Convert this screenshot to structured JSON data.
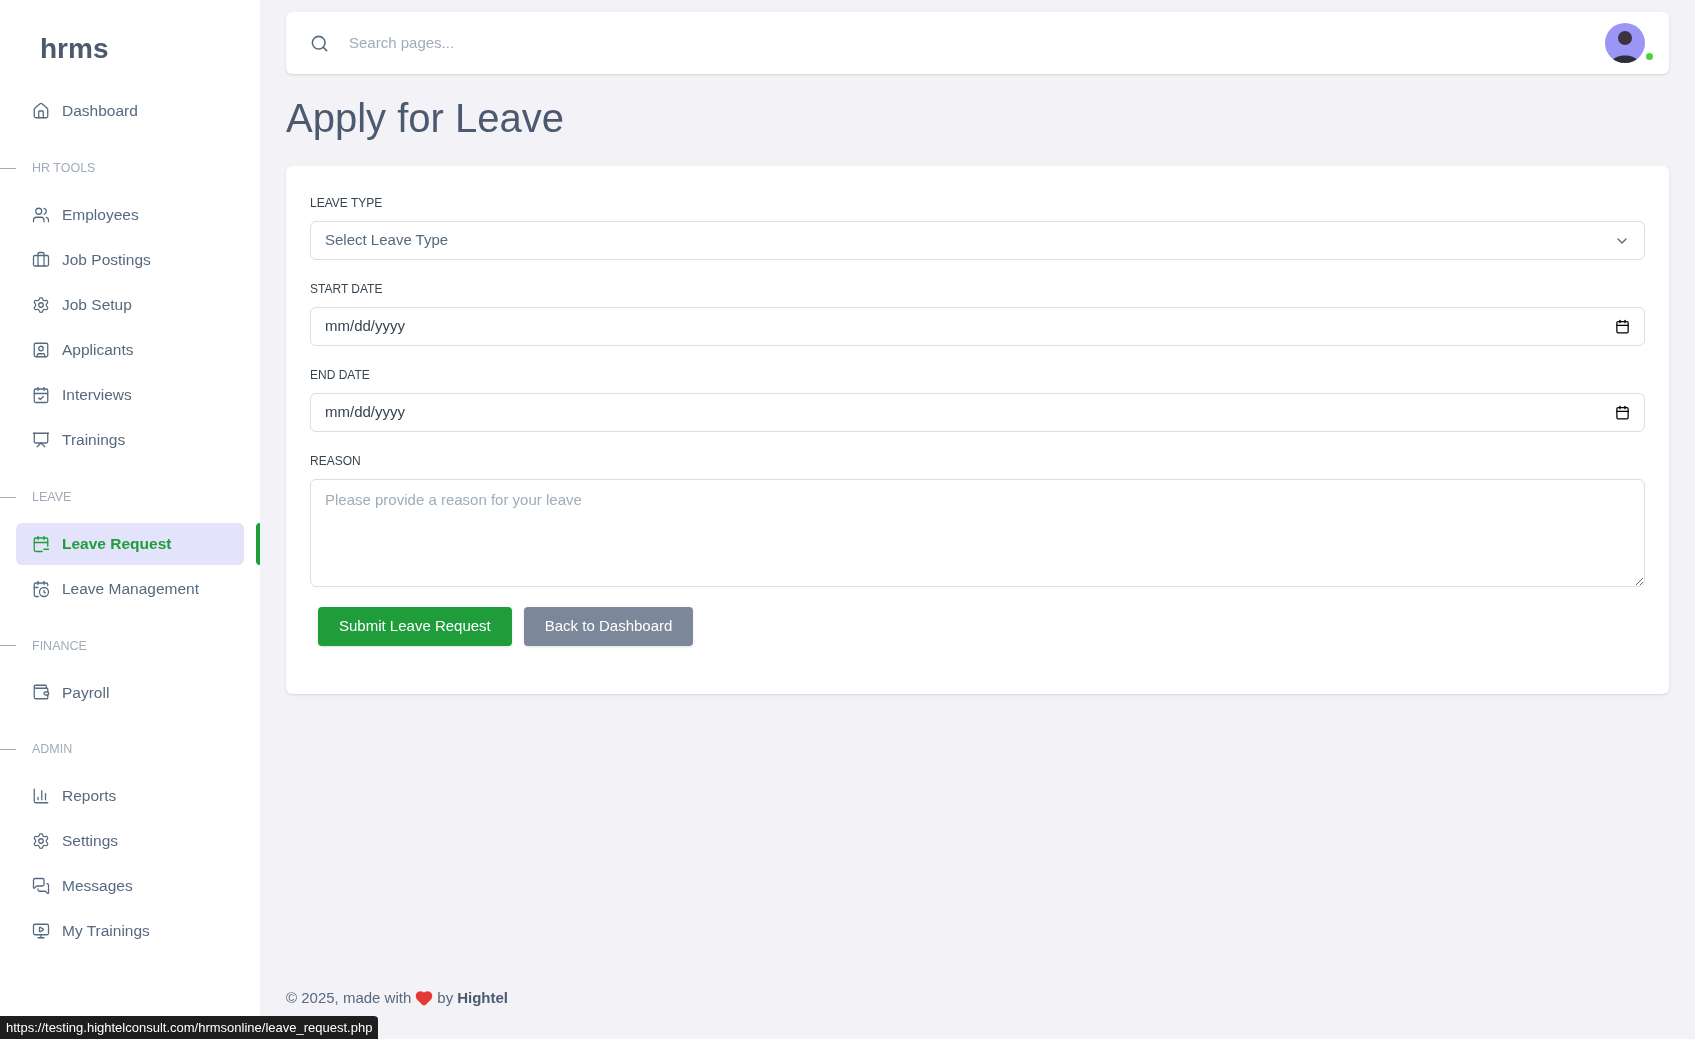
{
  "sidebar": {
    "logo": "hrms",
    "sections": [
      {
        "items": [
          {
            "label": "Dashboard",
            "selected": false
          }
        ]
      },
      {
        "heading": "HR TOOLS",
        "items": [
          {
            "label": "Employees",
            "selected": false
          },
          {
            "label": "Job Postings",
            "selected": false
          },
          {
            "label": "Job Setup",
            "selected": false
          },
          {
            "label": "Applicants",
            "selected": false
          },
          {
            "label": "Interviews",
            "selected": false
          },
          {
            "label": "Trainings",
            "selected": false
          }
        ]
      },
      {
        "heading": "LEAVE",
        "items": [
          {
            "label": "Leave Request",
            "selected": true
          },
          {
            "label": "Leave Management",
            "selected": false
          }
        ]
      },
      {
        "heading": "FINANCE",
        "items": [
          {
            "label": "Payroll",
            "selected": false
          }
        ]
      },
      {
        "heading": "ADMIN",
        "items": [
          {
            "label": "Reports",
            "selected": false
          },
          {
            "label": "Settings",
            "selected": false
          },
          {
            "label": "Messages",
            "selected": false
          },
          {
            "label": "My Trainings",
            "selected": false
          }
        ]
      }
    ]
  },
  "topbar": {
    "search": {
      "placeholder": "Search pages..."
    },
    "user": {
      "online": true
    }
  },
  "page_title": "Apply for Leave",
  "form": {
    "fields": [
      {
        "label": "LEAVE TYPE",
        "kind": "select",
        "placeholder": "Select Leave Type"
      },
      {
        "label": "START DATE",
        "kind": "date",
        "placeholder": "mm/dd/yyyy"
      },
      {
        "label": "END DATE",
        "kind": "date",
        "placeholder": "mm/dd/yyyy"
      },
      {
        "label": "REASON",
        "kind": "textarea",
        "placeholder": "Please provide a reason for your leave"
      }
    ],
    "buttons": [
      {
        "label": "Submit Leave Request",
        "kind": "primary"
      },
      {
        "label": "Back to Dashboard",
        "kind": "secondary"
      }
    ]
  },
  "footer": {
    "text": "© 2025, made with",
    "by": "by",
    "brand": "Hightel"
  },
  "status_url": "https://testing.hightelconsult.com/hrmsonline/leave_request.php"
}
